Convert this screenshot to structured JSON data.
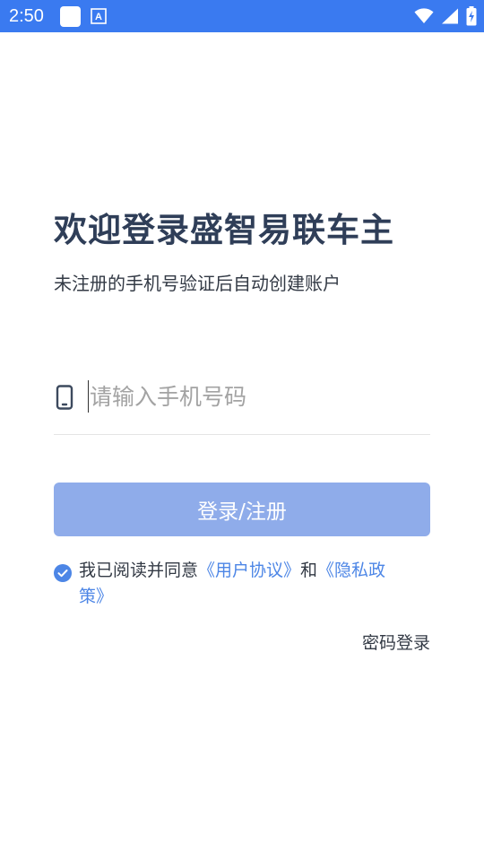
{
  "status_bar": {
    "time": "2:50",
    "icons": [
      "notification-square-icon",
      "font-a-icon",
      "wifi-icon",
      "signal-icon",
      "battery-charging-icon"
    ]
  },
  "login": {
    "title": "欢迎登录盛智易联车主",
    "subtitle": "未注册的手机号验证后自动创建账户",
    "phone_placeholder": "请输入手机号码",
    "phone_value": "",
    "login_button_label": "登录/注册",
    "agreement_prefix": "我已阅读并同意",
    "user_agreement": "《用户协议》",
    "agreement_and": "和",
    "privacy_policy": "《隐私政策》",
    "agreement_checked": true,
    "password_login": "密码登录"
  },
  "colors": {
    "status_bar": "#3a7af0",
    "title": "#2f3e58",
    "button": "#8facea",
    "link": "#4d86e6",
    "check": "#4d86e6"
  }
}
